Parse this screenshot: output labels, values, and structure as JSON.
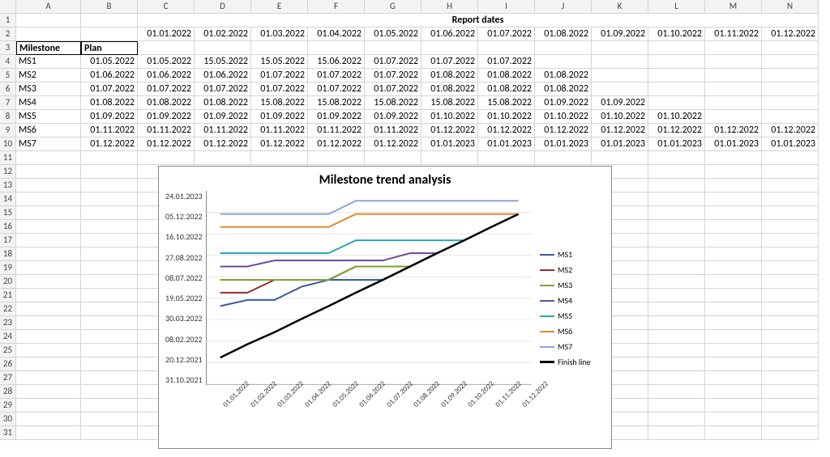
{
  "columns": [
    "",
    "A",
    "B",
    "C",
    "D",
    "E",
    "F",
    "G",
    "H",
    "I",
    "J",
    "K",
    "L",
    "M",
    "N"
  ],
  "row_numbers": [
    1,
    2,
    3,
    4,
    5,
    6,
    7,
    8,
    9,
    10,
    11,
    12,
    13,
    14,
    15,
    16,
    17,
    18,
    19,
    20,
    21,
    22,
    23,
    24,
    25,
    26,
    27,
    28,
    29,
    30,
    31
  ],
  "header1": {
    "label": "Report dates"
  },
  "report_dates": [
    "01.01.2022",
    "01.02.2022",
    "01.03.2022",
    "01.04.2022",
    "01.05.2022",
    "01.06.2022",
    "01.07.2022",
    "01.08.2022",
    "01.09.2022",
    "01.10.2022",
    "01.11.2022",
    "01.12.2022"
  ],
  "table_headers": {
    "milestone": "Milestone",
    "plan": "Plan"
  },
  "rows": [
    {
      "name": "MS1",
      "plan": "01.05.2022",
      "vals": [
        "01.05.2022",
        "15.05.2022",
        "15.05.2022",
        "15.06.2022",
        "01.07.2022",
        "01.07.2022",
        "01.07.2022",
        "",
        "",
        "",
        "",
        ""
      ]
    },
    {
      "name": "MS2",
      "plan": "01.06.2022",
      "vals": [
        "01.06.2022",
        "01.06.2022",
        "01.07.2022",
        "01.07.2022",
        "01.07.2022",
        "01.08.2022",
        "01.08.2022",
        "01.08.2022",
        "",
        "",
        "",
        ""
      ]
    },
    {
      "name": "MS3",
      "plan": "01.07.2022",
      "vals": [
        "01.07.2022",
        "01.07.2022",
        "01.07.2022",
        "01.07.2022",
        "01.07.2022",
        "01.08.2022",
        "01.08.2022",
        "01.08.2022",
        "",
        "",
        "",
        ""
      ]
    },
    {
      "name": "MS4",
      "plan": "01.08.2022",
      "vals": [
        "01.08.2022",
        "01.08.2022",
        "15.08.2022",
        "15.08.2022",
        "15.08.2022",
        "15.08.2022",
        "15.08.2022",
        "01.09.2022",
        "01.09.2022",
        "",
        "",
        ""
      ]
    },
    {
      "name": "MS5",
      "plan": "01.09.2022",
      "vals": [
        "01.09.2022",
        "01.09.2022",
        "01.09.2022",
        "01.09.2022",
        "01.09.2022",
        "01.10.2022",
        "01.10.2022",
        "01.10.2022",
        "01.10.2022",
        "01.10.2022",
        "",
        ""
      ]
    },
    {
      "name": "MS6",
      "plan": "01.11.2022",
      "vals": [
        "01.11.2022",
        "01.11.2022",
        "01.11.2022",
        "01.11.2022",
        "01.11.2022",
        "01.12.2022",
        "01.12.2022",
        "01.12.2022",
        "01.12.2022",
        "01.12.2022",
        "01.12.2022",
        "01.12.2022"
      ]
    },
    {
      "name": "MS7",
      "plan": "01.12.2022",
      "vals": [
        "01.12.2022",
        "01.12.2022",
        "01.12.2022",
        "01.12.2022",
        "01.12.2022",
        "01.01.2023",
        "01.01.2023",
        "01.01.2023",
        "01.01.2023",
        "01.01.2023",
        "01.01.2023",
        "01.01.2023"
      ]
    }
  ],
  "chart_data": {
    "type": "line",
    "title": "Milestone trend analysis",
    "xlabel": "",
    "ylabel": "",
    "x": [
      "01.01.2022",
      "01.02.2022",
      "01.03.2022",
      "01.04.2022",
      "01.05.2022",
      "01.06.2022",
      "01.07.2022",
      "01.08.2022",
      "01.09.2022",
      "01.10.2022",
      "01.11.2022",
      "01.12.2022"
    ],
    "y_ticks": [
      "24.01.2023",
      "05.12.2022",
      "16.10.2022",
      "27.08.2022",
      "08.07.2022",
      "19.05.2022",
      "30.03.2022",
      "08.02.2022",
      "20.12.2021",
      "31.10.2021"
    ],
    "series": [
      {
        "name": "MS1",
        "color": "#3b5aa3",
        "values": [
          "01.05.2022",
          "15.05.2022",
          "15.05.2022",
          "15.06.2022",
          "01.07.2022",
          "01.07.2022",
          "01.07.2022"
        ]
      },
      {
        "name": "MS2",
        "color": "#9d2b2b",
        "values": [
          "01.06.2022",
          "01.06.2022",
          "01.07.2022",
          "01.07.2022",
          "01.07.2022",
          "01.08.2022",
          "01.08.2022",
          "01.08.2022"
        ]
      },
      {
        "name": "MS3",
        "color": "#7aa32f",
        "values": [
          "01.07.2022",
          "01.07.2022",
          "01.07.2022",
          "01.07.2022",
          "01.07.2022",
          "01.08.2022",
          "01.08.2022",
          "01.08.2022"
        ]
      },
      {
        "name": "MS4",
        "color": "#6b4c9a",
        "values": [
          "01.08.2022",
          "01.08.2022",
          "15.08.2022",
          "15.08.2022",
          "15.08.2022",
          "15.08.2022",
          "15.08.2022",
          "01.09.2022",
          "01.09.2022"
        ]
      },
      {
        "name": "MS5",
        "color": "#2aa6b3",
        "values": [
          "01.09.2022",
          "01.09.2022",
          "01.09.2022",
          "01.09.2022",
          "01.09.2022",
          "01.10.2022",
          "01.10.2022",
          "01.10.2022",
          "01.10.2022",
          "01.10.2022"
        ]
      },
      {
        "name": "MS6",
        "color": "#e08b2a",
        "values": [
          "01.11.2022",
          "01.11.2022",
          "01.11.2022",
          "01.11.2022",
          "01.11.2022",
          "01.12.2022",
          "01.12.2022",
          "01.12.2022",
          "01.12.2022",
          "01.12.2022",
          "01.12.2022",
          "01.12.2022"
        ]
      },
      {
        "name": "MS7",
        "color": "#8aa5d6",
        "values": [
          "01.12.2022",
          "01.12.2022",
          "01.12.2022",
          "01.12.2022",
          "01.12.2022",
          "01.01.2023",
          "01.01.2023",
          "01.01.2023",
          "01.01.2023",
          "01.01.2023",
          "01.01.2023",
          "01.01.2023"
        ]
      },
      {
        "name": "Finish line",
        "color": "#000000",
        "width": 2.5,
        "values": [
          "01.01.2022",
          "01.02.2022",
          "01.03.2022",
          "01.04.2022",
          "01.05.2022",
          "01.06.2022",
          "01.07.2022",
          "01.08.2022",
          "01.09.2022",
          "01.10.2022",
          "01.11.2022",
          "01.12.2022"
        ]
      }
    ]
  }
}
